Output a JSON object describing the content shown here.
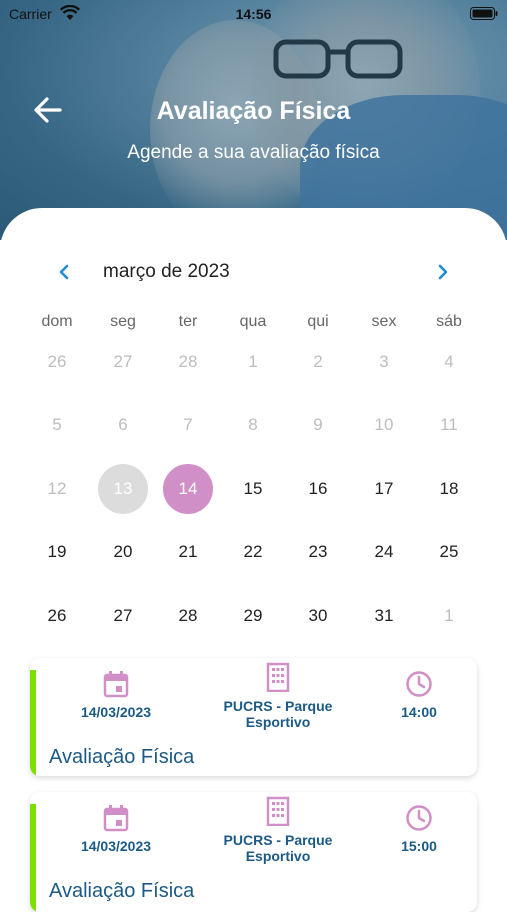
{
  "status_bar": {
    "carrier": "Carrier",
    "time": "14:56"
  },
  "header": {
    "title": "Avaliação Física",
    "subtitle": "Agende a sua avaliação física"
  },
  "calendar": {
    "month_label": "março de 2023",
    "weekdays": [
      "dom",
      "seg",
      "ter",
      "qua",
      "qui",
      "sex",
      "sáb"
    ],
    "weeks": [
      [
        {
          "d": "26",
          "s": "muted"
        },
        {
          "d": "27",
          "s": "muted"
        },
        {
          "d": "28",
          "s": "muted"
        },
        {
          "d": "1",
          "s": "muted"
        },
        {
          "d": "2",
          "s": "muted"
        },
        {
          "d": "3",
          "s": "muted"
        },
        {
          "d": "4",
          "s": "muted"
        }
      ],
      [
        {
          "d": "5",
          "s": "muted"
        },
        {
          "d": "6",
          "s": "muted"
        },
        {
          "d": "7",
          "s": "muted"
        },
        {
          "d": "8",
          "s": "muted"
        },
        {
          "d": "9",
          "s": "muted"
        },
        {
          "d": "10",
          "s": "muted"
        },
        {
          "d": "11",
          "s": "muted"
        }
      ],
      [
        {
          "d": "12",
          "s": "muted"
        },
        {
          "d": "13",
          "s": "today"
        },
        {
          "d": "14",
          "s": "selected"
        },
        {
          "d": "15",
          "s": "normal"
        },
        {
          "d": "16",
          "s": "normal"
        },
        {
          "d": "17",
          "s": "normal"
        },
        {
          "d": "18",
          "s": "normal"
        }
      ],
      [
        {
          "d": "19",
          "s": "normal"
        },
        {
          "d": "20",
          "s": "normal"
        },
        {
          "d": "21",
          "s": "normal"
        },
        {
          "d": "22",
          "s": "normal"
        },
        {
          "d": "23",
          "s": "normal"
        },
        {
          "d": "24",
          "s": "normal"
        },
        {
          "d": "25",
          "s": "normal"
        }
      ],
      [
        {
          "d": "26",
          "s": "normal"
        },
        {
          "d": "27",
          "s": "normal"
        },
        {
          "d": "28",
          "s": "normal"
        },
        {
          "d": "29",
          "s": "normal"
        },
        {
          "d": "30",
          "s": "normal"
        },
        {
          "d": "31",
          "s": "normal"
        },
        {
          "d": "1",
          "s": "muted"
        }
      ]
    ],
    "colors": {
      "selected": "#d18fc7",
      "today": "#dcdcdc",
      "nav": "#1e8ad6"
    }
  },
  "appointments": [
    {
      "date": "14/03/2023",
      "location_line1": "PUCRS - Parque",
      "location_line2": "Esportivo",
      "time": "14:00",
      "title": "Avaliação Física"
    },
    {
      "date": "14/03/2023",
      "location_line1": "PUCRS - Parque",
      "location_line2": "Esportivo",
      "time": "15:00",
      "title": "Avaliação Física"
    }
  ],
  "accent_colors": {
    "card_bar": "#7be000",
    "icon": "#d18fc7",
    "text": "#1c5a86"
  }
}
